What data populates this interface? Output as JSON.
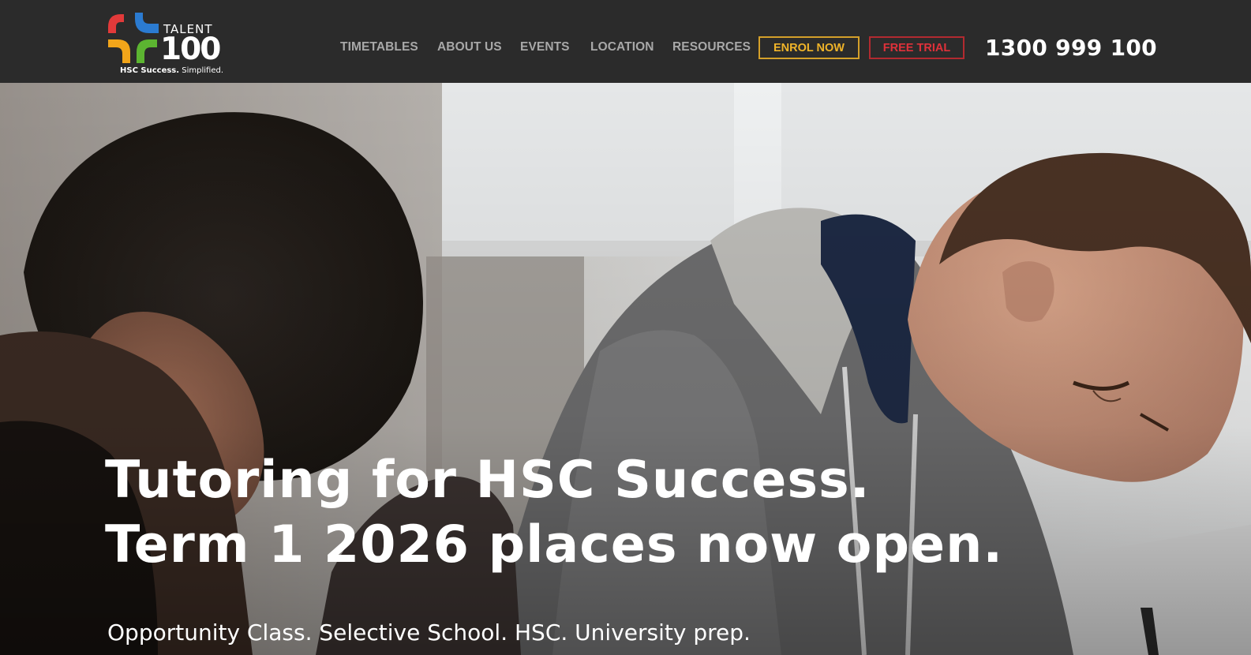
{
  "brand": {
    "word_talent": "TALENT",
    "word_100": "100",
    "tagline_bold": "HSC Success.",
    "tagline_light": "Simplified."
  },
  "nav": {
    "items": [
      {
        "label": "TIMETABLES"
      },
      {
        "label": "ABOUT US"
      },
      {
        "label": "EVENTS"
      },
      {
        "label": "LOCATION"
      },
      {
        "label": "RESOURCES"
      }
    ],
    "enrol_label": "ENROL NOW",
    "trial_label": "FREE TRIAL",
    "phone": "1300 999 100"
  },
  "hero": {
    "headline_line1": "Tutoring for HSC Success.",
    "headline_line2": "Term 1 2026 places now open.",
    "subheadline": "Opportunity Class. Selective School. HSC. University prep."
  },
  "colors": {
    "topbar_bg": "#2b2b2b",
    "nav_text": "#a8a8a8",
    "enrol_accent": "#f0b429",
    "trial_accent": "#e0313a",
    "logo_red": "#e23a3a",
    "logo_blue": "#2b7bd1",
    "logo_orange": "#f2a51a",
    "logo_green": "#5cb531"
  }
}
